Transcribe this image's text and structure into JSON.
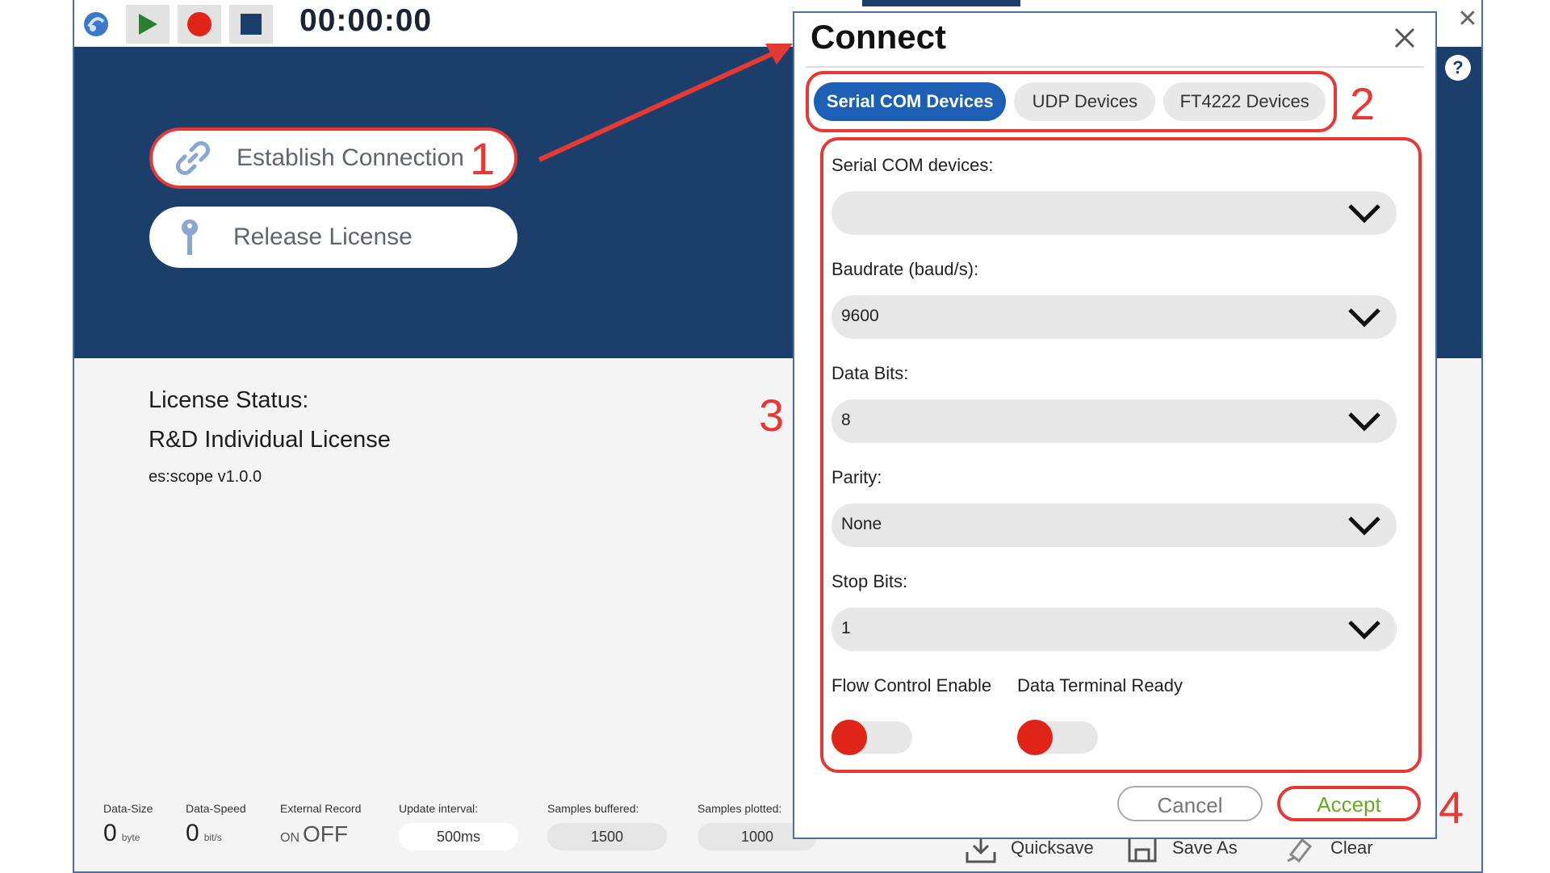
{
  "titlebar": {
    "timer": "00:00:00",
    "icons": [
      "app-logo-icon",
      "play-icon",
      "record-icon",
      "stop-icon"
    ]
  },
  "hero": {
    "establish_label": "Establish Connection",
    "release_label": "Release License"
  },
  "license": {
    "status_label": "License Status:",
    "license_name": "R&D Individual License",
    "version": "es:scope v1.0.0"
  },
  "statusbar": {
    "data_size": {
      "label": "Data-Size",
      "value": "0",
      "unit": "byte"
    },
    "data_speed": {
      "label": "Data-Speed",
      "value": "0",
      "unit": "bit/s"
    },
    "external_record": {
      "label": "External Record",
      "on": "ON",
      "off": "OFF"
    },
    "update_interval": {
      "label": "Update interval:",
      "value": "500ms"
    },
    "samples_buffered": {
      "label": "Samples buffered:",
      "value": "1500"
    },
    "samples_plotted": {
      "label": "Samples plotted:",
      "value": "1000"
    },
    "quicksave": "Quicksave",
    "save_as": "Save As",
    "clear": "Clear"
  },
  "dialog": {
    "title": "Connect",
    "tabs": [
      {
        "label": "Serial COM Devices",
        "active": true
      },
      {
        "label": "UDP Devices",
        "active": false
      },
      {
        "label": "FT4222 Devices",
        "active": false
      }
    ],
    "fields": [
      {
        "label": "Serial COM devices:",
        "value": ""
      },
      {
        "label": "Baudrate (baud/s):",
        "value": "9600"
      },
      {
        "label": "Data Bits:",
        "value": "8"
      },
      {
        "label": "Parity:",
        "value": "None"
      },
      {
        "label": "Stop Bits:",
        "value": "1"
      }
    ],
    "toggles": [
      {
        "label": "Flow Control Enable",
        "state": "off"
      },
      {
        "label": "Data Terminal Ready",
        "state": "off"
      }
    ],
    "cancel_label": "Cancel",
    "accept_label": "Accept"
  },
  "window": {
    "help": "?",
    "close": "✕"
  },
  "annotations": [
    "1",
    "2",
    "3",
    "4"
  ],
  "colors": {
    "accent": "#1b3f6a",
    "tab_active": "#1c5fb5",
    "highlight": "#e53935",
    "toggle_knob": "#e02418",
    "accept_text": "#6aaa1e"
  }
}
